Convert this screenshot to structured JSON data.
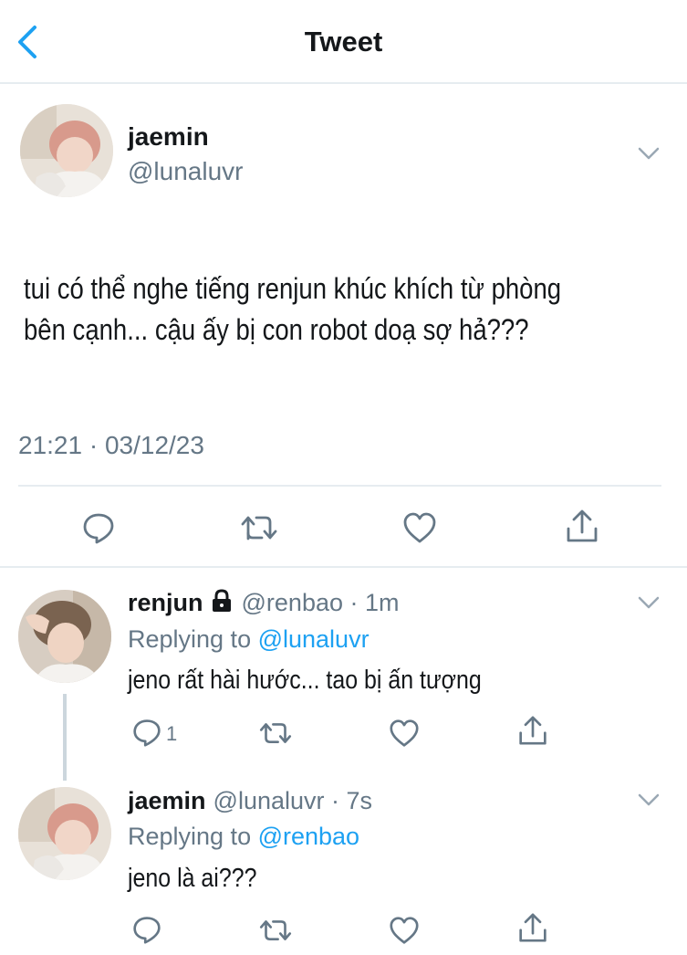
{
  "header": {
    "title": "Tweet",
    "back_icon": "chevron-left-icon"
  },
  "main_tweet": {
    "name": "jaemin",
    "handle": "@lunaluvr",
    "line1": "tui có thể nghe tiếng renjun khúc khích từ phòng",
    "line2": "bên cạnh... cậu ấy bị con robot doạ sợ hả???",
    "timestamp": "21:21 · 03/12/23",
    "actions": [
      "reply-icon",
      "retweet-icon",
      "like-icon",
      "share-icon"
    ]
  },
  "replies": [
    {
      "name": "renjun",
      "protected": true,
      "handle": "@renbao · 1m",
      "replying_prefix": "Replying to ",
      "replying_to": "@lunaluvr",
      "text": "jeno rất hài hước... tao bị ấn tượng",
      "reply_count": "1"
    },
    {
      "name": "jaemin",
      "protected": false,
      "handle": "@lunaluvr · 7s",
      "replying_prefix": "Replying to ",
      "replying_to": "@renbao",
      "text": "jeno là ai???",
      "reply_count": ""
    }
  ],
  "colors": {
    "accent": "#1da1f2",
    "secondary": "#657786",
    "text": "#14171a",
    "divider": "#e6ecf0"
  }
}
